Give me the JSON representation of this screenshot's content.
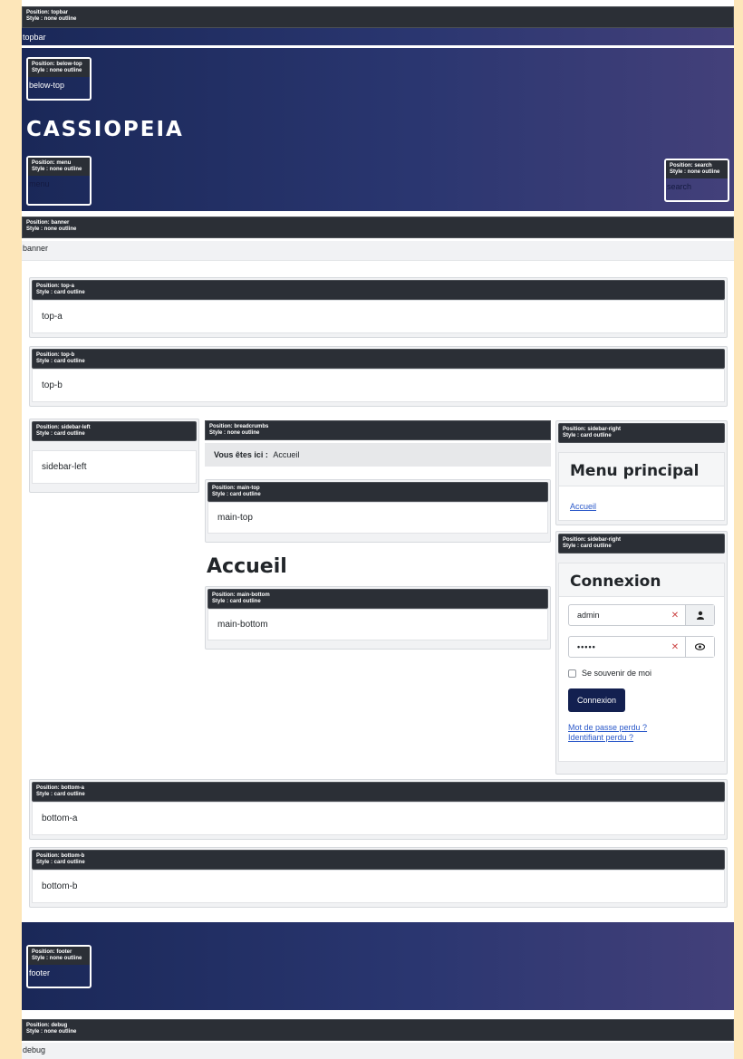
{
  "site": {
    "brand": "CASSIOPEIA"
  },
  "positions": {
    "topbar": {
      "label": "Position: topbar",
      "style": "Style : none outline",
      "text": "topbar"
    },
    "below_top": {
      "label": "Position: below-top",
      "style": "Style : none outline",
      "text": "below-top"
    },
    "menu": {
      "label": "Position: menu",
      "style": "Style : none outline",
      "text": "menu"
    },
    "search": {
      "label": "Position: search",
      "style": "Style : none outline",
      "text": "search"
    },
    "banner": {
      "label": "Position: banner",
      "style": "Style : none outline",
      "text": "banner"
    },
    "top_a": {
      "label": "Position: top-a",
      "style": "Style : card outline",
      "text": "top-a"
    },
    "top_b": {
      "label": "Position: top-b",
      "style": "Style : card outline",
      "text": "top-b"
    },
    "sidebar_left": {
      "label": "Position: sidebar-left",
      "style": "Style : card outline",
      "text": "sidebar-left"
    },
    "breadcrumbs": {
      "label": "Position: breadcrumbs",
      "style": "Style : none outline",
      "prefix": "Vous êtes ici :",
      "current": "Accueil"
    },
    "main_top": {
      "label": "Position: main-top",
      "style": "Style : card outline",
      "text": "main-top"
    },
    "main_bottom": {
      "label": "Position: main-bottom",
      "style": "Style : card outline",
      "text": "main-bottom"
    },
    "sidebar_right_menu": {
      "label": "Position: sidebar-right",
      "style": "Style : card outline",
      "heading": "Menu principal",
      "link": "Accueil"
    },
    "sidebar_right_login": {
      "label": "Position: sidebar-right",
      "style": "Style : card outline",
      "heading": "Connexion"
    },
    "bottom_a": {
      "label": "Position: bottom-a",
      "style": "Style : card outline",
      "text": "bottom-a"
    },
    "bottom_b": {
      "label": "Position: bottom-b",
      "style": "Style : card outline",
      "text": "bottom-b"
    },
    "footer": {
      "label": "Position: footer",
      "style": "Style : none outline",
      "text": "footer"
    },
    "debug": {
      "label": "Position: debug",
      "style": "Style : none outline",
      "text": "debug"
    }
  },
  "page": {
    "title": "Accueil"
  },
  "login": {
    "username": "admin",
    "password_mask": "•••••",
    "remember_label": "Se souvenir de moi",
    "submit_label": "Connexion",
    "forgot_password": "Mot de passe perdu ?",
    "forgot_username": "Identifiant perdu ?"
  },
  "icons": {
    "user": "user-icon",
    "eye": "eye-icon",
    "password_manager": "password-manager-icon"
  },
  "colors": {
    "header_gradient_start": "#1a2858",
    "header_gradient_end": "#43407a",
    "primary_button": "#132050",
    "link": "#2a58c9",
    "label_bar": "#2b2f36",
    "page_background": "#fde6b9"
  }
}
